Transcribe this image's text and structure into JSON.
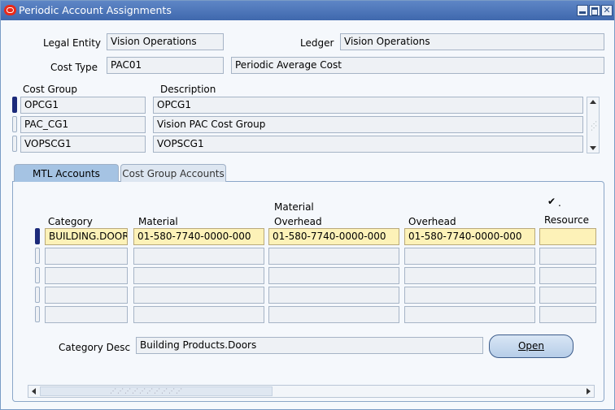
{
  "window": {
    "title": "Periodic Account Assignments"
  },
  "header": {
    "legal_entity_label": "Legal Entity",
    "legal_entity_value": "Vision Operations",
    "ledger_label": "Ledger",
    "ledger_value": "Vision Operations",
    "cost_type_label": "Cost Type",
    "cost_type_value": "PAC01",
    "cost_type_desc": "Periodic Average Cost"
  },
  "cost_groups": {
    "col_cost_group": "Cost Group",
    "col_description": "Description",
    "rows": [
      {
        "group": "OPCG1",
        "description": "OPCG1"
      },
      {
        "group": "PAC_CG1",
        "description": "Vision PAC Cost Group"
      },
      {
        "group": "VOPSCG1",
        "description": "VOPSCG1"
      }
    ]
  },
  "tabs": [
    {
      "label": "MTL Accounts"
    },
    {
      "label": "Cost Group Accounts"
    }
  ],
  "accounts": {
    "col_category": "Category",
    "col_material": "Material",
    "col_material_overhead_line1": "Material",
    "col_material_overhead_line2": "Overhead",
    "col_overhead": "Overhead",
    "col_resource": "Resource",
    "checkbox_mark": "✔",
    "checkbox_dot": ".",
    "rows": [
      {
        "category": "BUILDING.DOOR",
        "material": "01-580-7740-0000-000",
        "material_overhead": "01-580-7740-0000-000",
        "overhead": "01-580-7740-0000-000",
        "resource": ""
      }
    ]
  },
  "category_desc": {
    "label": "Category Desc",
    "value": "Building Products.Doors"
  },
  "open_button": {
    "label": "Open"
  }
}
